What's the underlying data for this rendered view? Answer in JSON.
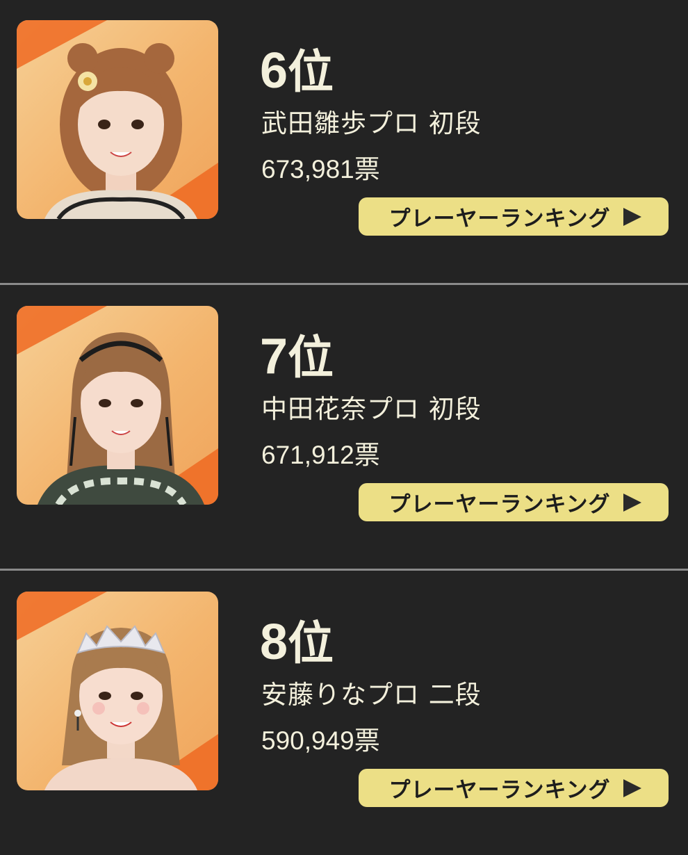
{
  "entries": [
    {
      "rank": "6",
      "rank_suffix": "位",
      "name": "武田雛歩プロ 初段",
      "votes": "673,981票",
      "button_label": "プレーヤーランキング",
      "button_icon": "play-triangle-icon"
    },
    {
      "rank": "7",
      "rank_suffix": "位",
      "name": "中田花奈プロ 初段",
      "votes": "671,912票",
      "button_label": "プレーヤーランキング",
      "button_icon": "play-triangle-icon"
    },
    {
      "rank": "8",
      "rank_suffix": "位",
      "name": "安藤りなプロ 二段",
      "votes": "590,949票",
      "button_label": "プレーヤーランキング",
      "button_icon": "play-triangle-icon"
    }
  ],
  "colors": {
    "background": "#232323",
    "text": "#f3f0dc",
    "button": "#ecdf86",
    "photo_accent": "#ee6a22",
    "divider": "#8a8a8a"
  }
}
